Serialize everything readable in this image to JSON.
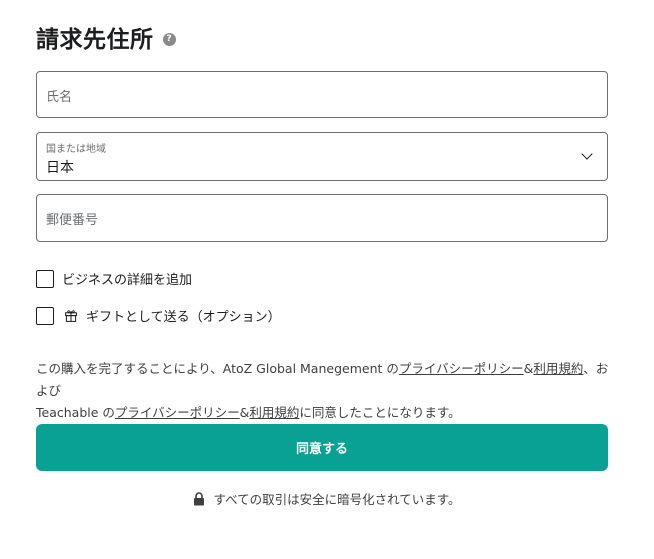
{
  "section": {
    "title": "請求先住所",
    "help_icon_glyph": "?"
  },
  "fields": {
    "name_placeholder": "氏名",
    "country_label": "国または地域",
    "country_value": "日本",
    "postal_placeholder": "郵便番号"
  },
  "checkboxes": {
    "business_label": "ビジネスの詳細を追加",
    "business_checked": false,
    "gift_label": "ギフトとして送る（オプション）",
    "gift_checked": false
  },
  "legal": {
    "part1": "この購入を完了することにより、AtoZ Global Manegement の",
    "privacy1": "プライバシーポリシー",
    "amp1": "&",
    "terms1": "利用規約",
    "part2": "、および",
    "part3": "Teachable の",
    "privacy2": "プライバシーポリシー",
    "amp2": "&",
    "terms2": "利用規約",
    "part4": "に同意したことになります。"
  },
  "actions": {
    "agree_label": "同意する"
  },
  "footer": {
    "secure_text": "すべての取引は安全に暗号化されています。"
  },
  "colors": {
    "primary": "#0aa195",
    "border": "#6a6f73",
    "text": "#1c1d1f"
  },
  "icons": {
    "help": "question-circle-icon",
    "chevron": "chevron-down-icon",
    "gift": "gift-icon",
    "lock": "lock-icon"
  }
}
